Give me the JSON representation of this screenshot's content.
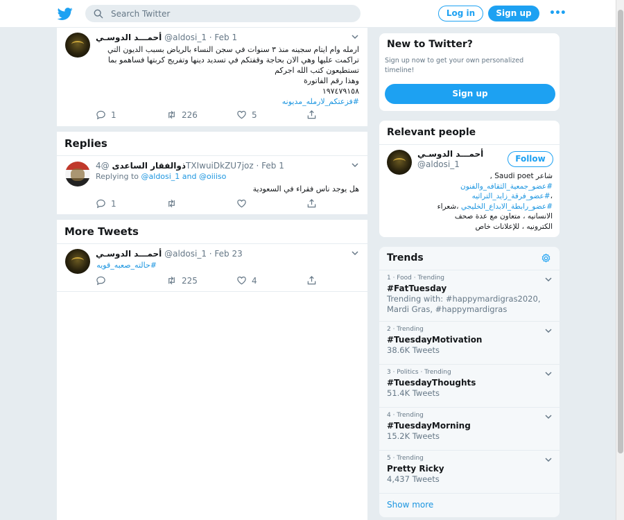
{
  "header": {
    "search_placeholder": "Search Twitter",
    "login_label": "Log in",
    "signup_label": "Sign up",
    "more_label": "•••"
  },
  "main_tweet": {
    "display_name": "أحمـــد الدوسـي",
    "handle_date": "@aldosi_1 · Feb 1",
    "text_lines": [
      "ارمله وام ايتام سجينه منذ ٣ سنوات في سجن النساء بالرياض بسبب الديون التي",
      "تراكمت عليها وهي الان بحاجة وقفتكم في تسديد دينها وتفريج كربتها فساهمو بما",
      "تستطيعون كتب الله اجركم",
      "وهذا رقم الفاتورة",
      "١٩٧٤٧٩١٥٨"
    ],
    "hashtag": "#فزعتكم_لارمله_مديونه",
    "replies": "1",
    "retweets": "226",
    "likes": "5"
  },
  "replies_section": {
    "title": "Replies",
    "reply": {
      "display_name": "ذوالفقار الساعدى",
      "handle_date": "@4TXIwuiDkZU7joz · Feb 1",
      "replying_prefix": "Replying to ",
      "replying_users": "@aldosi_1 and @oiiiso",
      "text": "هل يوجد ناس فقراء في السعودية",
      "replies": "1",
      "retweets": "",
      "likes": ""
    }
  },
  "more_tweets": {
    "title": "More Tweets",
    "tweet": {
      "display_name": "أحمـــد الدوسـي",
      "handle_date": "@aldosi_1 · Feb 23",
      "hashtag": "#حالته_صعبه_قويه",
      "replies": "",
      "retweets": "225",
      "likes": "4"
    }
  },
  "new_to_twitter": {
    "title": "New to Twitter?",
    "subtitle": "Sign up now to get your own personalized timeline!",
    "signup_label": "Sign up"
  },
  "relevant_people": {
    "title": "Relevant people",
    "display_name": "أحمـــد الدوسـي",
    "handle": "@aldosi_1",
    "follow_label": "Follow",
    "bio_line1": "شاعر Saudi poet ,",
    "bio_tag1": "#عضو_جمعية_الثقافه_والفنون",
    "bio_tag2": "#عضو_فرقة_زايد_التراثيه",
    "bio_tag2_prefix": "،",
    "bio_tag3": "#عضو_رابطة_الابداع_الخليجي",
    "bio_tag3_suffix": " ،شعراء",
    "bio_line5": "الانسانيه ، متعاون مع عدة صحف",
    "bio_line6": "الكترونيه ، للإعلانات خاص"
  },
  "trends": {
    "title": "Trends",
    "items": [
      {
        "meta": "1 · Food · Trending",
        "name": "#FatTuesday",
        "count": "Trending with: #happymardigras2020, Mardi Gras, #happymardigras"
      },
      {
        "meta": "2 · Trending",
        "name": "#TuesdayMotivation",
        "count": "38.6K Tweets"
      },
      {
        "meta": "3 · Politics · Trending",
        "name": "#TuesdayThoughts",
        "count": "51.4K Tweets"
      },
      {
        "meta": "4 · Trending",
        "name": "#TuesdayMorning",
        "count": "15.2K Tweets"
      },
      {
        "meta": "5 · Trending",
        "name": "Pretty Ricky",
        "count": "4,437 Tweets"
      }
    ],
    "show_more": "Show more"
  },
  "colors": {
    "accent": "#1da1f2",
    "link": "#1b95e0",
    "background": "#e6ecf0",
    "muted": "#657786"
  }
}
